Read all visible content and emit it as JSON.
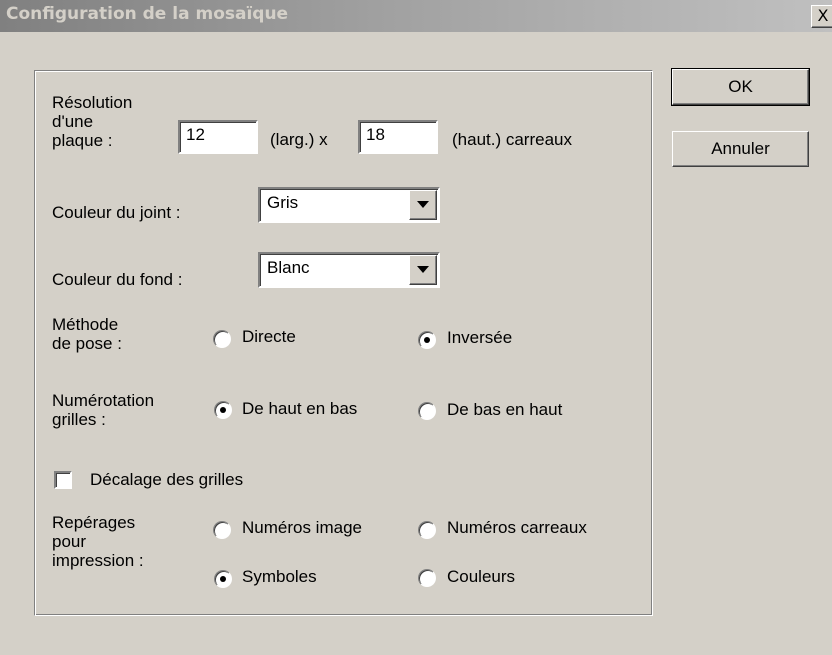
{
  "window": {
    "title": "Configuration de la mosaïque",
    "close_label": "X"
  },
  "resolution": {
    "label_lines": [
      "Résolution",
      "d'une",
      "plaque :"
    ],
    "width_value": "12",
    "width_suffix": "(larg.) x",
    "height_value": "18",
    "height_suffix": "(haut.) carreaux"
  },
  "joint_color": {
    "label": "Couleur du joint :",
    "selected": "Gris"
  },
  "background_color": {
    "label": "Couleur du fond :",
    "selected": "Blanc"
  },
  "method": {
    "label_lines": [
      "Méthode",
      "de pose :"
    ],
    "options": [
      {
        "label": "Directe",
        "checked": false
      },
      {
        "label": "Inversée",
        "checked": true
      }
    ]
  },
  "numbering": {
    "label_lines": [
      "Numérotation",
      "grilles :"
    ],
    "options": [
      {
        "label": "De haut en bas",
        "checked": true
      },
      {
        "label": "De bas en haut",
        "checked": false
      }
    ]
  },
  "offset": {
    "label": "Décalage des grilles",
    "checked": false
  },
  "markers": {
    "label_lines": [
      "Repérages",
      "pour",
      "impression :"
    ],
    "options": [
      {
        "label": "Numéros image",
        "checked": false
      },
      {
        "label": "Numéros carreaux",
        "checked": false
      },
      {
        "label": "Symboles",
        "checked": true
      },
      {
        "label": "Couleurs",
        "checked": false
      }
    ]
  },
  "buttons": {
    "ok": "OK",
    "cancel": "Annuler"
  }
}
